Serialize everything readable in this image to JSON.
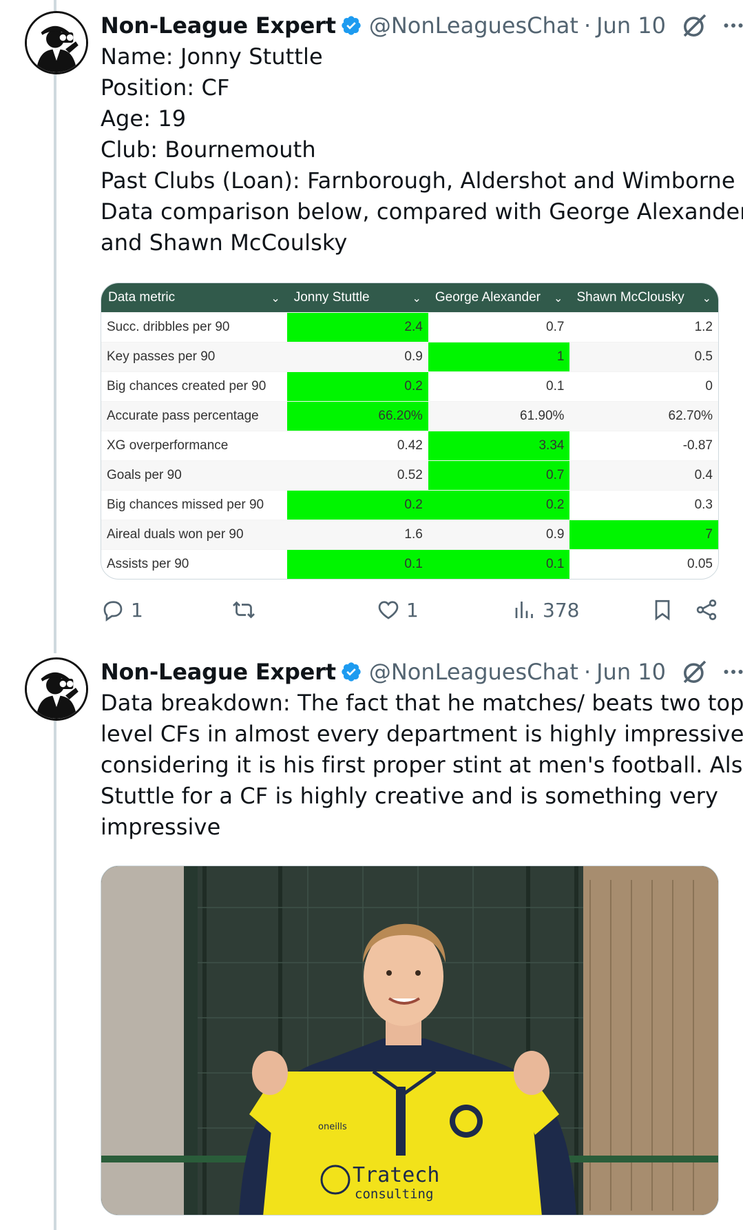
{
  "tweets": [
    {
      "author": "Non-League Expert",
      "handle": "@NonLeaguesChat",
      "separator": "·",
      "date": "Jun 10",
      "lines": [
        "Name: Jonny Stuttle",
        "Position: CF",
        "Age: 19",
        "Club: Bournemouth",
        "Past Clubs (Loan): Farnborough, Aldershot and Wimborne",
        "Data comparison below, compared with George Alexander",
        "and Shawn McCoulsky"
      ],
      "table": {
        "headers": [
          "Data metric",
          "Jonny Stuttle",
          "George Alexander",
          "Shawn McClousky"
        ],
        "rows": [
          {
            "metric": "Succ. dribbles per 90",
            "values": [
              "2.4",
              "0.7",
              "1.2"
            ],
            "highlight": [
              true,
              false,
              false
            ]
          },
          {
            "metric": "Key passes per 90",
            "values": [
              "0.9",
              "1",
              "0.5"
            ],
            "highlight": [
              false,
              true,
              false
            ]
          },
          {
            "metric": "Big chances created per 90",
            "values": [
              "0.2",
              "0.1",
              "0"
            ],
            "highlight": [
              true,
              false,
              false
            ]
          },
          {
            "metric": "Accurate pass percentage",
            "values": [
              "66.20%",
              "61.90%",
              "62.70%"
            ],
            "highlight": [
              true,
              false,
              false
            ]
          },
          {
            "metric": "XG overperformance",
            "values": [
              "0.42",
              "3.34",
              "-0.87"
            ],
            "highlight": [
              false,
              true,
              false
            ]
          },
          {
            "metric": "Goals per 90",
            "values": [
              "0.52",
              "0.7",
              "0.4"
            ],
            "highlight": [
              false,
              true,
              false
            ]
          },
          {
            "metric": "Big chances missed per 90",
            "values": [
              "0.2",
              "0.2",
              "0.3"
            ],
            "highlight": [
              true,
              true,
              false
            ]
          },
          {
            "metric": "Aireal duals won per 90",
            "values": [
              "1.6",
              "0.9",
              "7"
            ],
            "highlight": [
              false,
              false,
              true
            ]
          },
          {
            "metric": "Assists per 90",
            "values": [
              "0.1",
              "0.1",
              "0.05"
            ],
            "highlight": [
              true,
              true,
              false
            ]
          }
        ]
      },
      "actions": {
        "replies": "1",
        "retweets": "",
        "likes": "1",
        "views": "378"
      }
    },
    {
      "author": "Non-League Expert",
      "handle": "@NonLeaguesChat",
      "separator": "·",
      "date": "Jun 10",
      "lines": [
        "Data breakdown: The fact that he matches/ beats two top-",
        "level CFs in almost every department is highly impressive",
        "considering it is his first proper stint at men's football. Also,",
        "Stuttle for a CF is highly creative and is something very",
        "impressive"
      ],
      "photo": {
        "shirt_sponsor": "Tratech",
        "shirt_sponsor_sub": "consulting",
        "kit_brand": "oneills"
      }
    }
  ],
  "colors": {
    "accent": "#1d9bf0",
    "highlight": "#00f500",
    "table_header": "#315a4b",
    "muted": "#536471"
  }
}
